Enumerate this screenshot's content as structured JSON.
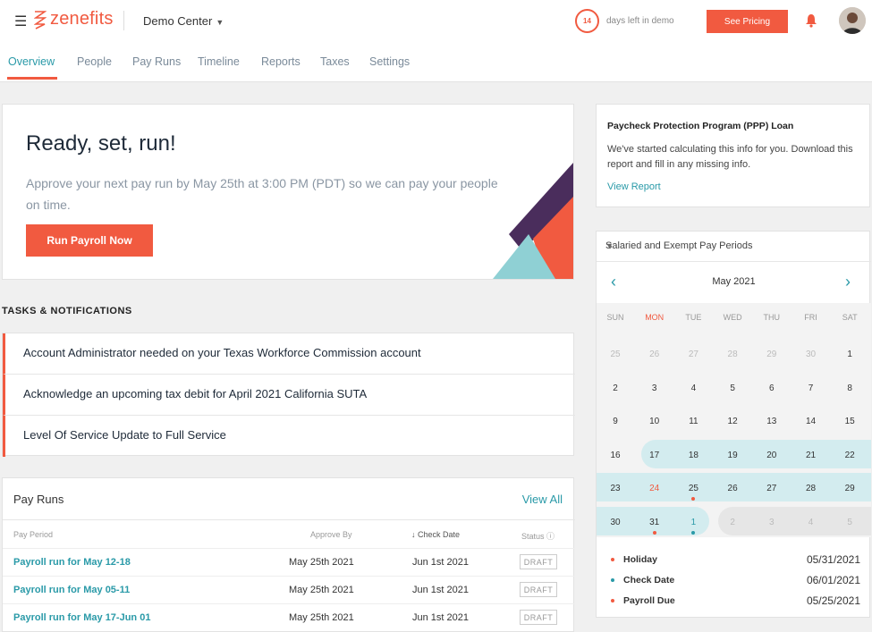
{
  "brand": {
    "name": "zenefits",
    "accent": "#f15a40",
    "link": "#2a9aa8"
  },
  "header": {
    "company": "Demo Center",
    "days_left": "14",
    "days_left_text": "days left in demo",
    "pricing_button": "See Pricing"
  },
  "tabs": [
    {
      "label": "Overview",
      "active": true
    },
    {
      "label": "People"
    },
    {
      "label": "Pay Runs"
    },
    {
      "label": "Timeline"
    },
    {
      "label": "Reports"
    },
    {
      "label": "Taxes"
    },
    {
      "label": "Settings"
    }
  ],
  "hero": {
    "title": "Ready, set, run!",
    "subtitle": "Approve your next pay run by May 25th at 3:00 PM (PDT) so we can pay your people on time.",
    "button": "Run Payroll Now"
  },
  "tasks": {
    "heading": "TASKS & NOTIFICATIONS",
    "items": [
      "Account Administrator needed on your Texas Workforce Commission account",
      "Acknowledge an upcoming tax debit for April 2021 California SUTA",
      "Level Of Service Update to Full Service"
    ]
  },
  "pay_runs": {
    "title": "Pay Runs",
    "view_all": "View All",
    "columns": {
      "period": "Pay Period",
      "approve_by": "Approve By",
      "check_date": "Check Date",
      "status": "Status"
    },
    "rows": [
      {
        "period": "Payroll run for May 12-18",
        "approve_by": "May 25th 2021",
        "check_date": "Jun 1st 2021",
        "status": "DRAFT"
      },
      {
        "period": "Payroll run for May 05-11",
        "approve_by": "May 25th 2021",
        "check_date": "Jun 1st 2021",
        "status": "DRAFT"
      },
      {
        "period": "Payroll run for May 17-Jun 01",
        "approve_by": "May 25th 2021",
        "check_date": "Jun 1st 2021",
        "status": "DRAFT"
      }
    ]
  },
  "ppp": {
    "title": "Paycheck Protection Program (PPP) Loan",
    "body": "We've started calculating this info for you. Download this report and fill in any missing info.",
    "link": "View Report"
  },
  "calendar": {
    "selector": "Salaried and Exempt Pay Periods",
    "month": "May 2021",
    "weekdays": [
      "SUN",
      "MON",
      "TUE",
      "WED",
      "THU",
      "FRI",
      "SAT"
    ],
    "weeks": [
      [
        "25",
        "26",
        "27",
        "28",
        "29",
        "30",
        "1"
      ],
      [
        "2",
        "3",
        "4",
        "5",
        "6",
        "7",
        "8"
      ],
      [
        "9",
        "10",
        "11",
        "12",
        "13",
        "14",
        "15"
      ],
      [
        "16",
        "17",
        "18",
        "19",
        "20",
        "21",
        "22"
      ],
      [
        "23",
        "24",
        "25",
        "26",
        "27",
        "28",
        "29"
      ],
      [
        "30",
        "31",
        "1",
        "2",
        "3",
        "4",
        "5"
      ]
    ],
    "legend": [
      {
        "name": "Holiday",
        "date": "05/31/2021",
        "color": "#f15a40"
      },
      {
        "name": "Check Date",
        "date": "06/01/2021",
        "color": "#2a9aa8"
      },
      {
        "name": "Payroll Due",
        "date": "05/25/2021",
        "color": "#f15a40"
      }
    ]
  }
}
